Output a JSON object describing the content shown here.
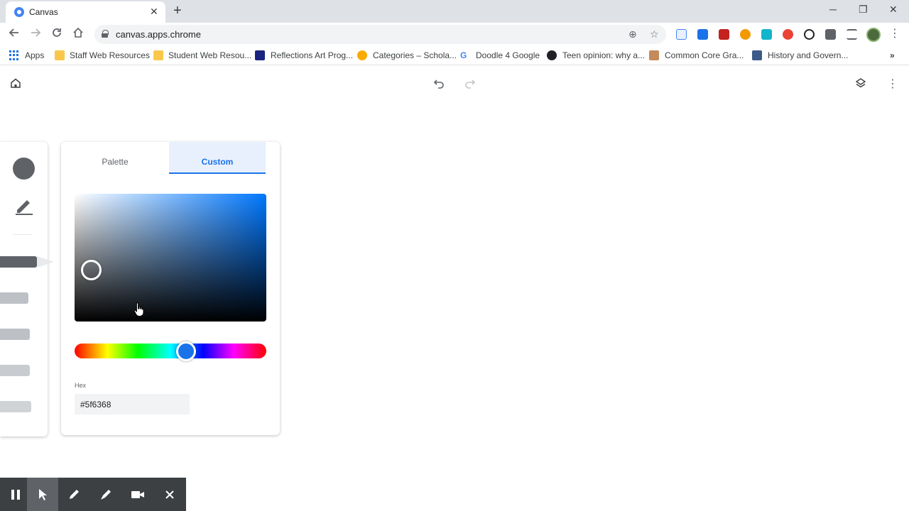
{
  "browser": {
    "tab_title": "Canvas",
    "url": "canvas.apps.chrome",
    "bookmarks": [
      {
        "label": "Apps",
        "icon": "apps-grid-icon"
      },
      {
        "label": "Staff Web Resources",
        "icon": "folder-icon"
      },
      {
        "label": "Student Web Resou...",
        "icon": "folder-icon"
      },
      {
        "label": "Reflections Art Prog...",
        "icon": "reflections-icon"
      },
      {
        "label": "Categories – Schola...",
        "icon": "categories-icon"
      },
      {
        "label": "Doodle 4 Google",
        "icon": "google-icon"
      },
      {
        "label": "Teen opinion: why a...",
        "icon": "teen-opinion-icon"
      },
      {
        "label": "Common Core Gra...",
        "icon": "common-core-icon"
      },
      {
        "label": "History and Govern...",
        "icon": "history-icon"
      }
    ],
    "more_bookmarks": "»"
  },
  "color_picker": {
    "tabs": [
      {
        "label": "Palette"
      },
      {
        "label": "Custom",
        "selected": true
      }
    ],
    "hex_label": "Hex",
    "hex_value": "#5f6368",
    "current_color": "#5f6368",
    "hue_color": "#1a73e8"
  },
  "colors": {
    "accent": "#1a73e8",
    "tab_selected_bg": "#e8f0fe",
    "recording_bar": "#3c4043"
  }
}
